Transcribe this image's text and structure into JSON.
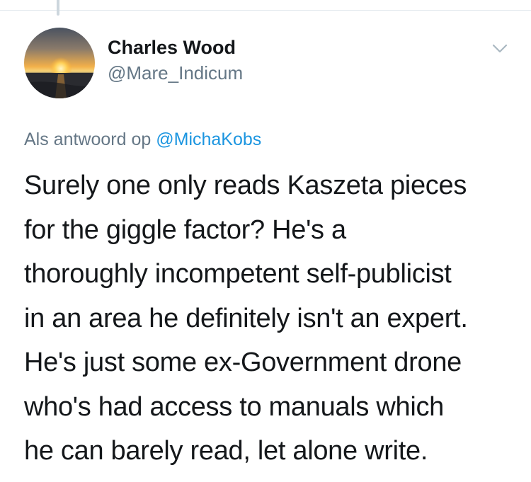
{
  "tweet": {
    "author": {
      "display_name": "Charles Wood",
      "handle": "@Mare_Indicum"
    },
    "reply_context": {
      "prefix": "Als antwoord op",
      "mention": "@MichaKobs"
    },
    "text_lines": [
      "Surely one only reads Kaszeta pieces",
      "for the giggle factor? He's a",
      "thoroughly incompetent self-publicist",
      "in an area he definitely isn't an expert.",
      "He's just some ex-Government drone",
      "who's had access to manuals which",
      "he can barely read, let alone write."
    ]
  },
  "icons": {
    "avatar": "sunset-over-sea-avatar",
    "menu": "chevron-down-icon"
  },
  "colors": {
    "text_primary": "#14171a",
    "text_secondary": "#657786",
    "link": "#1b95e0",
    "divider": "#e1e8ed"
  }
}
